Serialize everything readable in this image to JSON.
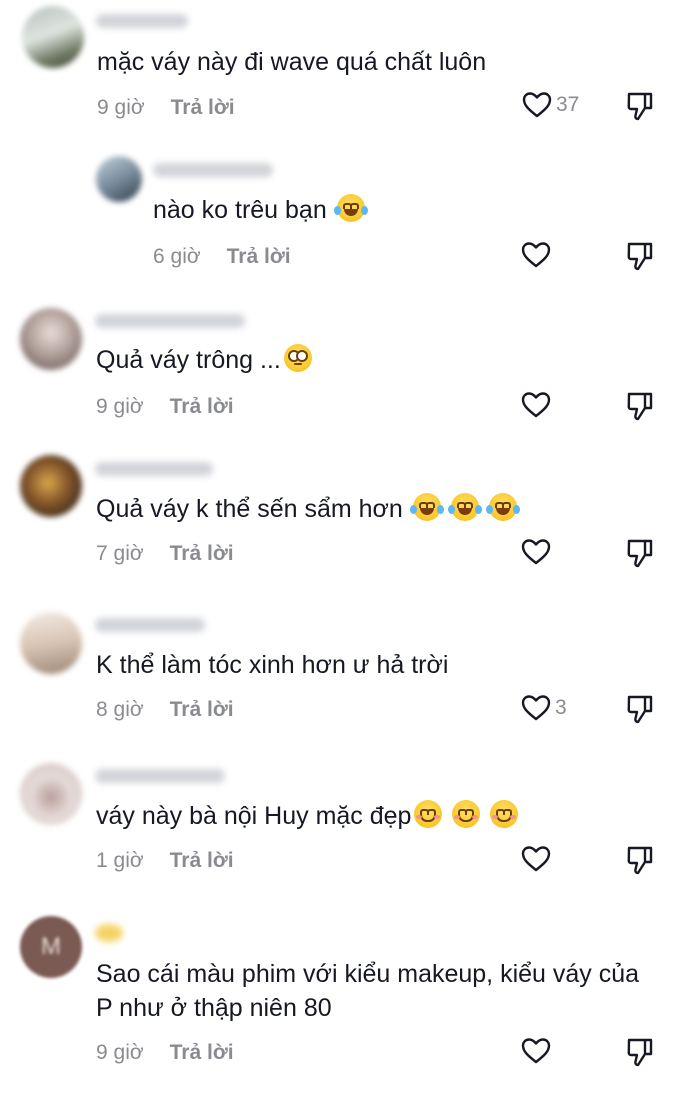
{
  "comments": [
    {
      "text": "mặc váy này đi wave quá chất luôn",
      "time": "9 giờ",
      "reply_label": "Trả lời",
      "likes": "37",
      "avatar_colors": [
        "#9aa7a0",
        "#55604a"
      ]
    },
    {
      "text": "nào ko trêu bạn",
      "emojis": [
        "laugh"
      ],
      "time": "6 giờ",
      "reply_label": "Trả lời",
      "likes": "",
      "avatar_colors": [
        "#9fb4c6",
        "#3b4a58"
      ]
    },
    {
      "text": "Quả váy trông ...",
      "emojis": [
        "roll"
      ],
      "time": "9 giờ",
      "reply_label": "Trả lời",
      "likes": "",
      "avatar_colors": [
        "#c9b7b0",
        "#6a5a57"
      ]
    },
    {
      "text": "Quả váy k thể sến sẩm hơn",
      "emojis": [
        "laugh",
        "laugh",
        "laugh"
      ],
      "time": "7 giờ",
      "reply_label": "Trả lời",
      "likes": "",
      "avatar_colors": [
        "#b28a5a",
        "#4b3522"
      ]
    },
    {
      "text": "K thể làm tóc xinh hơn ư hả trời",
      "time": "8 giờ",
      "reply_label": "Trả lời",
      "likes": "3",
      "avatar_colors": [
        "#e3d2c4",
        "#a38f7f"
      ]
    },
    {
      "text": "váy này bà nội Huy mặc đẹp",
      "emojis": [
        "smile",
        "smile",
        "smile"
      ],
      "time": "1 giờ",
      "reply_label": "Trả lời",
      "likes": "",
      "avatar_colors": [
        "#d9c9c6",
        "#8a7572"
      ]
    },
    {
      "text": "Sao cái màu phim với kiểu makeup, kiểu váy của P như ở thập niên 80",
      "time": "9 giờ",
      "reply_label": "Trả lời",
      "likes": "",
      "avatar_colors": [
        "#8a6e66",
        "#6b4f47"
      ],
      "avatar_letter": "M"
    }
  ],
  "colors": {
    "text": "#161823",
    "meta": "#8a8b91",
    "username_blur": "#c9ccd3"
  }
}
